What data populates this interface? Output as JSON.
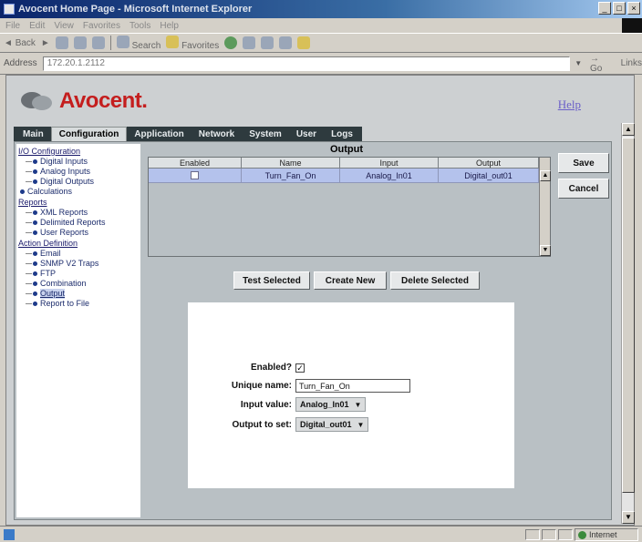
{
  "window": {
    "title": "Avocent Home Page - Microsoft Internet Explorer",
    "controls": [
      "_",
      "□",
      "×"
    ]
  },
  "menu": [
    "File",
    "Edit",
    "View",
    "Favorites",
    "Tools",
    "Help"
  ],
  "toolbar": {
    "back_label": "Back",
    "search_label": "Search",
    "favorites_label": "Favorites"
  },
  "address": {
    "label": "Address",
    "value": "172.20.1.2112",
    "go_label": "Go",
    "links_label": "Links"
  },
  "header": {
    "logo_text": "Avocent.",
    "help_label": "Help"
  },
  "tabs": [
    {
      "label": "Main"
    },
    {
      "label": "Configuration"
    },
    {
      "label": "Application"
    },
    {
      "label": "Network"
    },
    {
      "label": "System"
    },
    {
      "label": "User"
    },
    {
      "label": "Logs"
    }
  ],
  "active_tab": "Configuration",
  "tree": {
    "groups": [
      {
        "label": "I/O Configuration",
        "items": [
          "Digital Inputs",
          "Analog Inputs",
          "Digital Outputs"
        ]
      },
      {
        "label": "Calculations",
        "items": []
      },
      {
        "label": "Reports",
        "items": [
          "XML Reports",
          "Delimited Reports",
          "User Reports"
        ]
      },
      {
        "label": "Action Definition",
        "items": [
          "Email",
          "SNMP V2 Traps",
          "FTP",
          "Combination",
          "Output",
          "Report to File"
        ]
      }
    ],
    "selected": "Output"
  },
  "output_table": {
    "title": "Output",
    "columns": [
      "Enabled",
      "Name",
      "Input",
      "Output"
    ],
    "rows": [
      {
        "enabled": false,
        "name": "Turn_Fan_On",
        "input": "Analog_In01",
        "output": "Digital_out01"
      }
    ]
  },
  "buttons": {
    "save": "Save",
    "cancel": "Cancel",
    "test_selected": "Test Selected",
    "create_new": "Create New",
    "delete_selected": "Delete Selected"
  },
  "form": {
    "enabled_label": "Enabled?",
    "enabled_checked": true,
    "enabled_mark": "✓",
    "unique_name_label": "Unique name:",
    "unique_name_value": "Turn_Fan_On",
    "input_value_label": "Input value:",
    "input_value_selected": "Analog_In01",
    "output_label": "Output to set:",
    "output_selected": "Digital_out01"
  },
  "status": {
    "zone": "Internet"
  }
}
